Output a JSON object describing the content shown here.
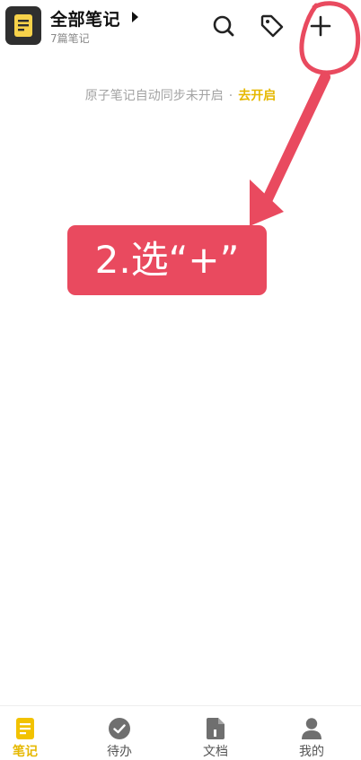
{
  "header": {
    "title": "全部笔记",
    "subtitle": "7篇笔记"
  },
  "sync_banner": {
    "text": "原子笔记自动同步未开启",
    "separator": "·",
    "link": "去开启"
  },
  "annotation": {
    "text": "2.选“+”"
  },
  "tabs": [
    {
      "label": "笔记",
      "icon": "note-icon",
      "active": true
    },
    {
      "label": "待办",
      "icon": "check-circle-icon",
      "active": false
    },
    {
      "label": "文档",
      "icon": "document-icon",
      "active": false
    },
    {
      "label": "我的",
      "icon": "person-icon",
      "active": false
    }
  ],
  "colors": {
    "accent": "#e6b800",
    "annotation": "#e94a5f"
  }
}
